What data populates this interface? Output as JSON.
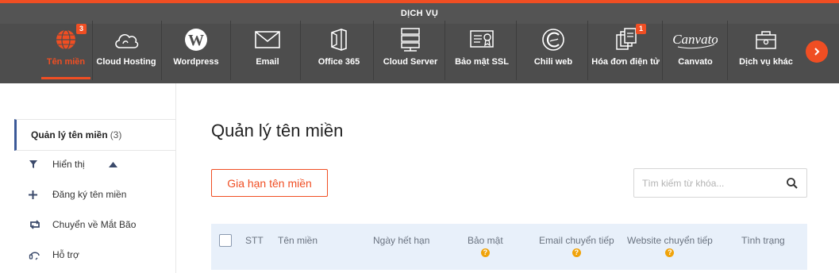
{
  "header": {
    "title": "DỊCH VỤ",
    "services": [
      {
        "label": "Tên miền",
        "icon": "globe-icon",
        "badge": "3",
        "active": true
      },
      {
        "label": "Cloud Hosting",
        "icon": "cloud-icon"
      },
      {
        "label": "Wordpress",
        "icon": "wordpress-icon"
      },
      {
        "label": "Email",
        "icon": "envelope-icon"
      },
      {
        "label": "Office 365",
        "icon": "office-icon"
      },
      {
        "label": "Cloud Server",
        "icon": "server-icon"
      },
      {
        "label": "Bảo mật SSL",
        "icon": "certificate-icon"
      },
      {
        "label": "Chili web",
        "icon": "chili-icon"
      },
      {
        "label": "Hóa đơn điện tử",
        "icon": "invoice-icon",
        "badge": "1"
      },
      {
        "label": "Canvato",
        "icon": "canvato-logo"
      },
      {
        "label": "Dịch vụ khác",
        "icon": "package-icon"
      }
    ],
    "accent": "#f04e23",
    "bar_color": "#4d4d4d"
  },
  "sidebar": {
    "active": {
      "label": "Quản lý tên miền",
      "count": "(3)"
    },
    "items": [
      {
        "label": "Hiển thị",
        "icon": "filter-icon"
      },
      {
        "label": "Đăng ký tên miền",
        "icon": "plus-icon"
      },
      {
        "label": "Chuyển về Mắt Bão",
        "icon": "transfer-icon"
      },
      {
        "label": "Hỗ trợ",
        "icon": "support-icon"
      }
    ]
  },
  "main": {
    "title": "Quản lý tên miền",
    "renew_label": "Gia hạn tên miền",
    "search_placeholder": "Tìm kiếm từ khóa...",
    "columns": [
      "STT",
      "Tên miền",
      "Ngày hết hạn",
      "Bảo mật",
      "Email chuyển tiếp",
      "Website chuyển tiếp",
      "Tình trạng"
    ],
    "info_glyph": "?"
  }
}
